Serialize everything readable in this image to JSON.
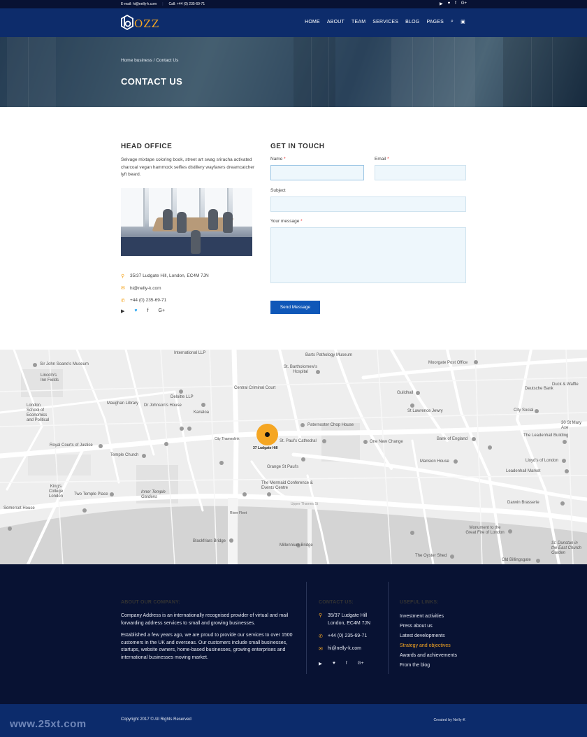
{
  "topbar": {
    "email_label": "E-mail:",
    "email": "hi@nelly-k.com",
    "call_label": "Call:",
    "phone": "+44 (0) 235-69-71",
    "social_icons": [
      "youtube-icon",
      "twitter-icon",
      "facebook-icon",
      "google-plus-icon"
    ]
  },
  "nav": {
    "logo_text": "OZZ",
    "items": [
      "HOME",
      "ABOUT",
      "TEAM",
      "SERVICES",
      "BLOG",
      "PAGES"
    ],
    "icons": [
      "search-icon",
      "cart-icon"
    ]
  },
  "hero": {
    "breadcrumb": "Home business / Contact Us",
    "title": "CONTACT US"
  },
  "office": {
    "title": "HEAD OFFICE",
    "text": "Selvage mixtape coloring book, street art swag sriracha activated charcoal vegan hammock selfies distillery wayfarers dreamcatcher lyft beard.",
    "address": "35/37 Ludgate Hill, London, EC4M 7JN",
    "email": "hi@nelly-k.com",
    "phone": "+44 (0) 235-69-71"
  },
  "form": {
    "title": "GET IN TOUCH",
    "name_label": "Name",
    "email_label": "Email",
    "subject_label": "Subject",
    "message_label": "Your message",
    "required_mark": "*",
    "send_label": "Send Message"
  },
  "map": {
    "pin_label": "37 Ludgate Hill",
    "labels": [
      {
        "text": "Sir John Soane's Museum"
      },
      {
        "text": "Lincoln's Inn Fields"
      },
      {
        "text": "London School of Economics and Political"
      },
      {
        "text": "Royal Courts of Justice"
      },
      {
        "text": "Temple Church"
      },
      {
        "text": "King's College London"
      },
      {
        "text": "Two Temple Place"
      },
      {
        "text": "Inner Temple Gardens"
      },
      {
        "text": "Somerset House"
      },
      {
        "text": "Maughan Library"
      },
      {
        "text": "Dr Johnson's House"
      },
      {
        "text": "Deloitte LLP"
      },
      {
        "text": "Kanaloa"
      },
      {
        "text": "Central Criminal Court"
      },
      {
        "text": "Barts Pathology Museum"
      },
      {
        "text": "St. Bartholomew's Hospital"
      },
      {
        "text": "Paternoster Chop House"
      },
      {
        "text": "St. Paul's Cathedral"
      },
      {
        "text": "Grange St Paul's"
      },
      {
        "text": "The Mermaid Conference & Events Centre"
      },
      {
        "text": "City Thameslink"
      },
      {
        "text": "Blackfriars Bridge"
      },
      {
        "text": "Millennium Bridge"
      },
      {
        "text": "Moorgate Post Office"
      },
      {
        "text": "Guildhall"
      },
      {
        "text": "St Lawrence Jewry"
      },
      {
        "text": "One New Change"
      },
      {
        "text": "Bank of England"
      },
      {
        "text": "Mansion House"
      },
      {
        "text": "City Social"
      },
      {
        "text": "Deutsche Bank"
      },
      {
        "text": "Duck & Waffle"
      },
      {
        "text": "30 St Mary Axe"
      },
      {
        "text": "The Leadenhall Building"
      },
      {
        "text": "Lloyd's of London"
      },
      {
        "text": "Leadenhall Market"
      },
      {
        "text": "Darwin Brasserie"
      },
      {
        "text": "Monument to the Great Fire of London"
      },
      {
        "text": "St. Dunstan in the East Church Garden"
      },
      {
        "text": "The Oyster Shed"
      },
      {
        "text": "Old Billingsgate"
      },
      {
        "text": "International LLP"
      },
      {
        "text": "River Fleet"
      },
      {
        "text": "Upper Thames St"
      }
    ]
  },
  "footer": {
    "about_title": "ABOUT OUR COMPANY:",
    "about_p1": "Company Address is an internationally recognised provider of virtual and mail forwarding address services to small and growing businesses.",
    "about_p2": "Established a few years ago, we are proud to provide our services to over 1500 customers in the UK and overseas. Our customers include small businesses, startups, website owners, home-based businesses, growing enterprises and international businesses moving market.",
    "contact_title": "CONTACT US:",
    "address_line1": "35/37 Ludgate Hill",
    "address_line2": "London, EC4M 7JN",
    "phone": "+44 (0) 235-69-71",
    "email": "hi@nelly-k.com",
    "links_title": "USEFUL LINKS:",
    "links": [
      "Investment activities",
      "Press about us",
      "Latest developments",
      "Strategy and objectives",
      "Awards and achievements",
      "From the blog"
    ],
    "active_link": "Strategy and objectives",
    "accent_color": "#f5a623"
  },
  "bottom": {
    "copyright": "Copyright 2017 © All Rights Reserved",
    "credit": "Created by Nelly-K",
    "watermark": "www.25xt.com"
  }
}
